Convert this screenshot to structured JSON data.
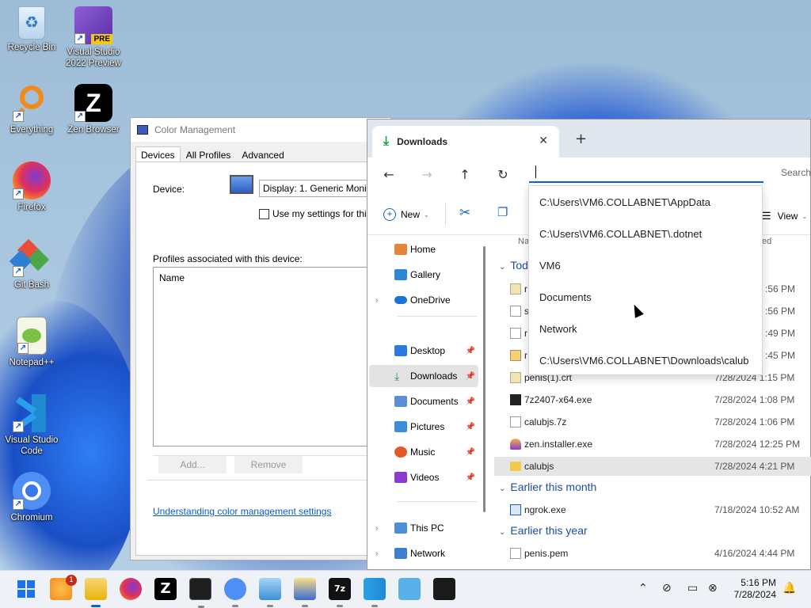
{
  "desktop": {
    "icons": [
      {
        "label": "Recycle Bin",
        "icon": "recycle-bin-icon"
      },
      {
        "label": "Visual Studio 2022 Preview",
        "icon": "visual-studio-preview-icon",
        "badge": "PRE"
      },
      {
        "label": "Everything",
        "icon": "everything-search-icon"
      },
      {
        "label": "Zen Browser",
        "icon": "zen-browser-icon",
        "glyph": "Z"
      },
      {
        "label": "Firefox",
        "icon": "firefox-icon"
      },
      {
        "label": "Git Bash",
        "icon": "git-bash-icon"
      },
      {
        "label": "Notepad++",
        "icon": "notepad-plus-plus-icon"
      },
      {
        "label": "Visual Studio Code",
        "icon": "vscode-icon"
      },
      {
        "label": "Chromium",
        "icon": "chromium-icon"
      }
    ]
  },
  "color_management": {
    "title": "Color Management",
    "tabs": [
      "Devices",
      "All Profiles",
      "Advanced"
    ],
    "device_label": "Device:",
    "device_value": "Display: 1. Generic Monito",
    "use_my_settings": "Use my settings for this",
    "profiles_label": "Profiles associated with this device:",
    "list_header": "Name",
    "add_button": "Add...",
    "remove_button": "Remove",
    "help_link": "Understanding color management settings"
  },
  "explorer": {
    "tab_title": "Downloads",
    "new_tab": "+",
    "search_placeholder": "Search",
    "command_bar": {
      "new_label": "New",
      "view_label": "View"
    },
    "column_name": "Na",
    "column_modified": "ed",
    "nav": [
      {
        "label": "Home",
        "icon": "home-icon"
      },
      {
        "label": "Gallery",
        "icon": "gallery-icon"
      },
      {
        "label": "OneDrive",
        "icon": "onedrive-icon",
        "expandable": true
      },
      {
        "label": "Desktop",
        "icon": "desktop-folder-icon",
        "pinned": true
      },
      {
        "label": "Downloads",
        "icon": "downloads-folder-icon",
        "pinned": true,
        "selected": true
      },
      {
        "label": "Documents",
        "icon": "documents-folder-icon",
        "pinned": true
      },
      {
        "label": "Pictures",
        "icon": "pictures-folder-icon",
        "pinned": true
      },
      {
        "label": "Music",
        "icon": "music-folder-icon",
        "pinned": true
      },
      {
        "label": "Videos",
        "icon": "videos-folder-icon",
        "pinned": true
      },
      {
        "label": "This PC",
        "icon": "this-pc-icon",
        "expandable": true
      },
      {
        "label": "Network",
        "icon": "network-icon",
        "expandable": true
      }
    ],
    "groups": {
      "today": "Tod",
      "earlier_month": "Earlier this month",
      "earlier_year": "Earlier this year"
    },
    "files": [
      {
        "name": "r",
        "date": ":56 PM"
      },
      {
        "name": "s",
        "date": ":56 PM"
      },
      {
        "name": "r",
        "date": ":49 PM"
      },
      {
        "name": "r",
        "date": ":45 PM"
      },
      {
        "name": "penis(1).crt",
        "date": "7/28/2024 1:15 PM"
      },
      {
        "name": "7z2407-x64.exe",
        "date": "7/28/2024 1:08 PM"
      },
      {
        "name": "calubjs.7z",
        "date": "7/28/2024 1:06 PM"
      },
      {
        "name": "zen.installer.exe",
        "date": "7/28/2024 12:25 PM"
      },
      {
        "name": "calubjs",
        "date": "7/28/2024 4:21 PM",
        "selected": true
      }
    ],
    "files_month": [
      {
        "name": "ngrok.exe",
        "date": "7/18/2024 10:52 AM"
      }
    ],
    "files_year": [
      {
        "name": "penis.pem",
        "date": "4/16/2024 4:44 PM"
      }
    ]
  },
  "address_dropdown": [
    "C:\\Users\\VM6.COLLABNET\\AppData",
    "C:\\Users\\VM6.COLLABNET\\.dotnet",
    "VM6",
    "Documents",
    "Network",
    "C:\\Users\\VM6.COLLABNET\\Downloads\\calub"
  ],
  "taskbar": {
    "apps": [
      "start-icon",
      "widgets-icon",
      "file-explorer-icon",
      "firefox-icon",
      "zen-browser-icon",
      "terminal-icon",
      "chromium-icon",
      "control-panel-icon",
      "color-management-icon",
      "7zip-icon",
      "vscode-icon",
      "notepad-icon",
      "snipping-icon"
    ],
    "widgets_badge": "1",
    "time": "5:16 PM",
    "date": "7/28/2024"
  }
}
